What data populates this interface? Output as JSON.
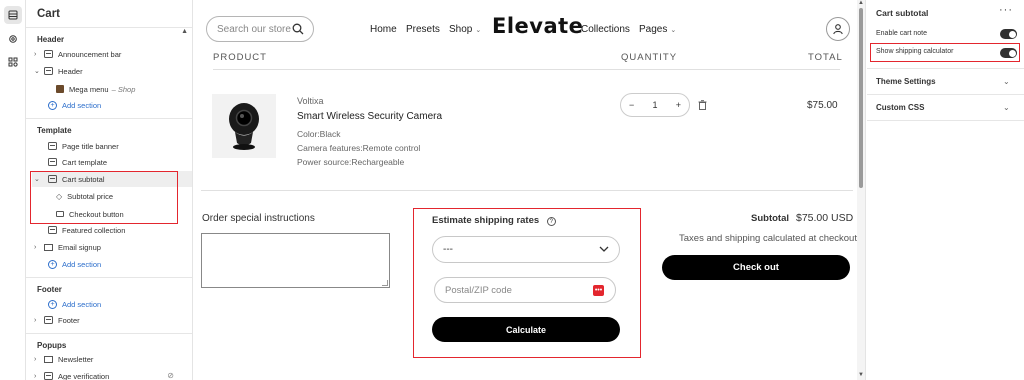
{
  "panel": {
    "title": "Cart",
    "groups": {
      "header": "Header",
      "template": "Template",
      "footer": "Footer",
      "popups": "Popups"
    },
    "items": {
      "announcement_bar": "Announcement bar",
      "header": "Header",
      "mega_menu": "Mega menu",
      "mega_menu_suffix": "– Shop",
      "add_section": "Add section",
      "page_title_banner": "Page title banner",
      "cart_template": "Cart template",
      "cart_subtotal": "Cart subtotal",
      "subtotal_price": "Subtotal price",
      "checkout_button": "Checkout button",
      "featured_collection": "Featured collection",
      "email_signup": "Email signup",
      "footer": "Footer",
      "newsletter": "Newsletter",
      "age_verification": "Age verification"
    }
  },
  "store": {
    "search_placeholder": "Search our store",
    "nav": {
      "home": "Home",
      "presets": "Presets",
      "shop": "Shop",
      "collections": "Collections",
      "pages": "Pages"
    },
    "logo": "Elevate",
    "columns": {
      "product": "PRODUCT",
      "quantity": "QUANTITY",
      "total": "TOTAL"
    },
    "product": {
      "vendor": "Voltixa",
      "name": "Smart Wireless Security Camera",
      "color": "Color:Black",
      "features": "Camera features:Remote control",
      "power": "Power source:Rechargeable",
      "quantity": "1",
      "price": "$75.00"
    },
    "instructions_label": "Order special instructions",
    "shipping": {
      "title": "Estimate shipping rates",
      "country_value": "---",
      "zip_placeholder": "Postal/ZIP code",
      "calculate": "Calculate"
    },
    "summary": {
      "subtotal_label": "Subtotal",
      "subtotal_value": "$75.00 USD",
      "tax_note": "Taxes and shipping calculated at checkout",
      "checkout": "Check out"
    }
  },
  "settings": {
    "title": "Cart subtotal",
    "enable_cart_note": "Enable cart note",
    "show_shipping_calculator": "Show shipping calculator",
    "enable_cart_note_on": true,
    "show_shipping_calculator_on": true,
    "theme_settings": "Theme Settings",
    "custom_css": "Custom CSS"
  },
  "colors": {
    "highlight": "#e3262e",
    "link": "#2c6ecb",
    "button": "#000000"
  }
}
